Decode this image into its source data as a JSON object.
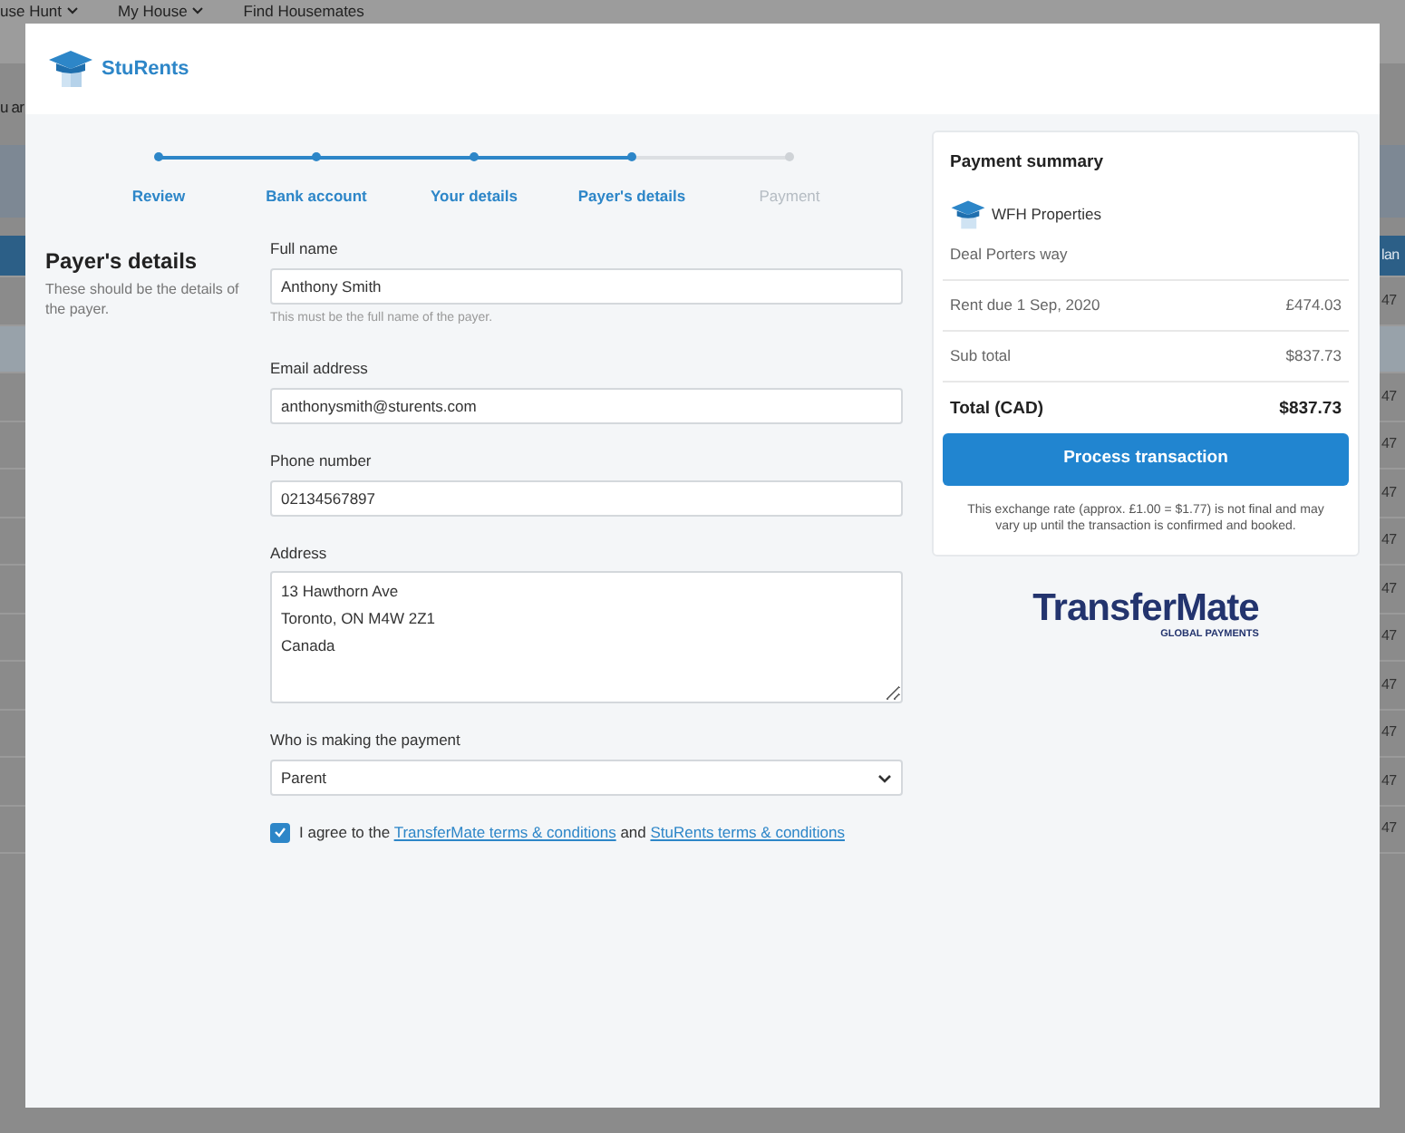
{
  "background": {
    "nav": [
      {
        "label": "use Hunt",
        "dropdown": true
      },
      {
        "label": "My House",
        "dropdown": true
      },
      {
        "label": "Find Housemates",
        "dropdown": false
      }
    ],
    "notice": "u ar",
    "table": {
      "header": "lan",
      "rows": [
        {
          "kind": "data",
          "text": "47"
        },
        {
          "kind": "section"
        },
        {
          "kind": "data",
          "text": "47"
        },
        {
          "kind": "data",
          "text": "47"
        },
        {
          "kind": "data",
          "text": "47"
        },
        {
          "kind": "data",
          "text": "47"
        },
        {
          "kind": "data",
          "text": "47"
        },
        {
          "kind": "data",
          "text": "47"
        },
        {
          "kind": "data",
          "text": "47"
        },
        {
          "kind": "data",
          "text": "47"
        },
        {
          "kind": "data",
          "text": "47"
        },
        {
          "kind": "data",
          "text": "47"
        }
      ]
    }
  },
  "modal": {
    "brand": "StuRents",
    "steps": [
      {
        "label": "Review",
        "completed": true
      },
      {
        "label": "Bank account",
        "completed": true
      },
      {
        "label": "Your details",
        "completed": true
      },
      {
        "label": "Payer's details",
        "completed": true
      },
      {
        "label": "Payment",
        "completed": false
      }
    ],
    "section": {
      "title": "Payer's details",
      "description": "These should be the details of the payer."
    },
    "fields": [
      {
        "kind": "text",
        "label": "Full name",
        "value": "Anthony Smith",
        "help": "This must be the full name of the payer."
      },
      {
        "kind": "text",
        "label": "Email address",
        "value": "anthonysmith@sturents.com"
      },
      {
        "kind": "text",
        "label": "Phone number",
        "value": "02134567897"
      },
      {
        "kind": "textarea",
        "label": "Address",
        "value": "13 Hawthorn Ave\nToronto, ON M4W 2Z1\nCanada"
      },
      {
        "kind": "select",
        "label": "Who is making the payment",
        "value": "Parent"
      }
    ],
    "agreement": {
      "checked": true,
      "parts": [
        {
          "kind": "text",
          "text": "I agree to the "
        },
        {
          "kind": "link",
          "text": "TransferMate terms & conditions"
        },
        {
          "kind": "text",
          "text": " and "
        },
        {
          "kind": "link",
          "text": "StuRents terms & conditions"
        }
      ]
    },
    "summary": {
      "title": "Payment summary",
      "landlord": "WFH Properties",
      "property": "Deal Porters way",
      "lines": [
        {
          "kind": "line",
          "label": "Rent due 1 Sep, 2020",
          "amount": "£474.03"
        },
        {
          "kind": "line",
          "label": "Sub total",
          "amount": "$837.73"
        },
        {
          "kind": "total",
          "label": "Total (CAD)",
          "amount": "$837.73"
        }
      ],
      "button": "Process transaction",
      "note": "This exchange rate (approx. £1.00 = $1.77) is not final and may vary up until the transaction is confirmed and booked."
    },
    "partner": {
      "name": "TransferMate",
      "tagline": "GLOBAL PAYMENTS"
    }
  }
}
